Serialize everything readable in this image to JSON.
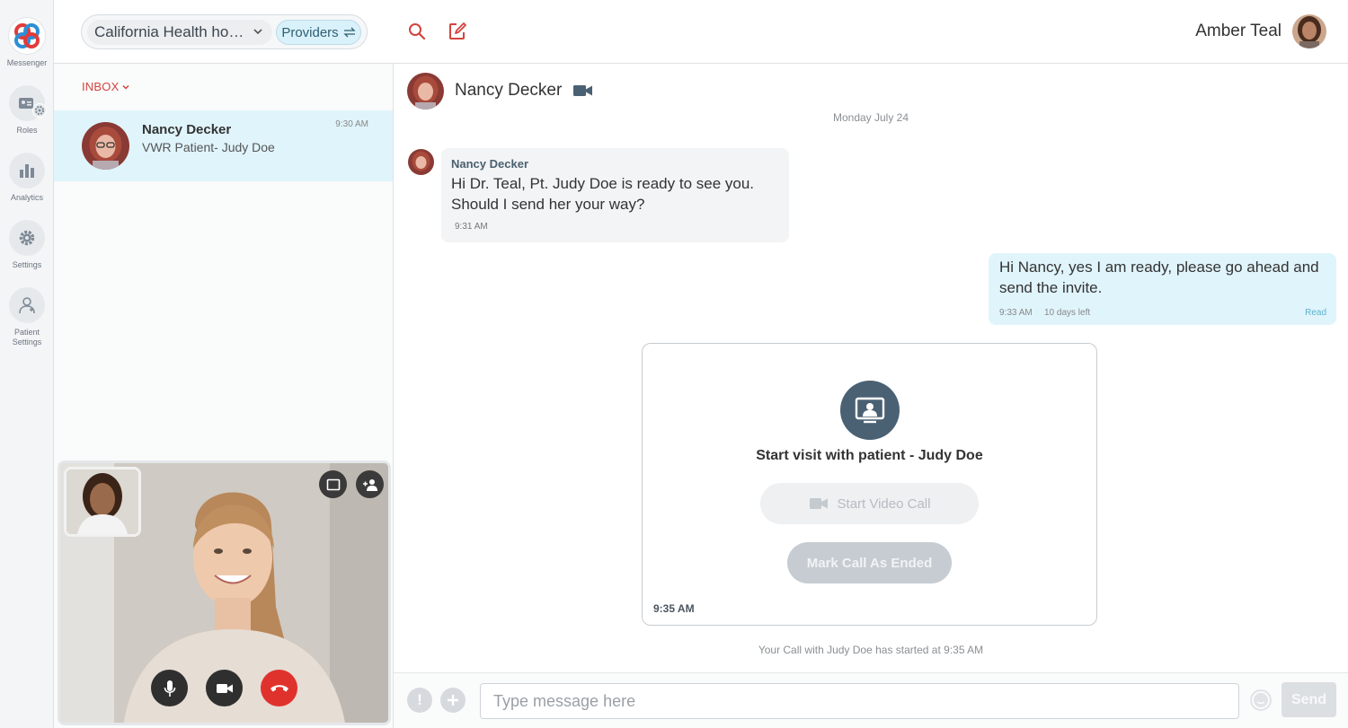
{
  "rail": {
    "items": [
      {
        "label": "Messenger",
        "icon": "messenger-logo-icon"
      },
      {
        "label": "Roles",
        "icon": "roles-icon"
      },
      {
        "label": "Analytics",
        "icon": "bar-chart-icon"
      },
      {
        "label": "Settings",
        "icon": "gear-icon"
      },
      {
        "label": "Patient\nSettings",
        "icon": "patient-icon"
      }
    ]
  },
  "topbar": {
    "org": "California Health hospital",
    "providers_label": "Providers",
    "user_name": "Amber Teal"
  },
  "inbox": {
    "label": "INBOX",
    "conversations": [
      {
        "name": "Nancy Decker",
        "subtitle": "VWR Patient- Judy Doe",
        "time": "9:30 AM"
      }
    ]
  },
  "chat": {
    "contact_name": "Nancy Decker",
    "date_separator": "Monday July 24",
    "messages": [
      {
        "sender": "Nancy Decker",
        "body": "Hi Dr. Teal, Pt. Judy Doe is ready to see you.  Should I send her your way?",
        "time": "9:31 AM"
      },
      {
        "body": "Hi Nancy, yes I am ready, please go ahead and send the invite.",
        "time": "9:33 AM",
        "expires": "10 days left",
        "status": "Read"
      }
    ],
    "visit_card": {
      "title": "Start visit with patient - Judy Doe",
      "start_video_label": "Start Video Call",
      "mark_ended_label": "Mark Call As Ended",
      "time": "9:35 AM"
    },
    "call_status": "Your Call with Judy Doe has started at 9:35 AM"
  },
  "composer": {
    "placeholder": "Type message here",
    "send_label": "Send"
  },
  "colors": {
    "accent_red": "#d3433e",
    "selected_bg": "#e0f4fb",
    "visit_icon_bg": "#4a6173",
    "end_call_red": "#e0322c"
  }
}
